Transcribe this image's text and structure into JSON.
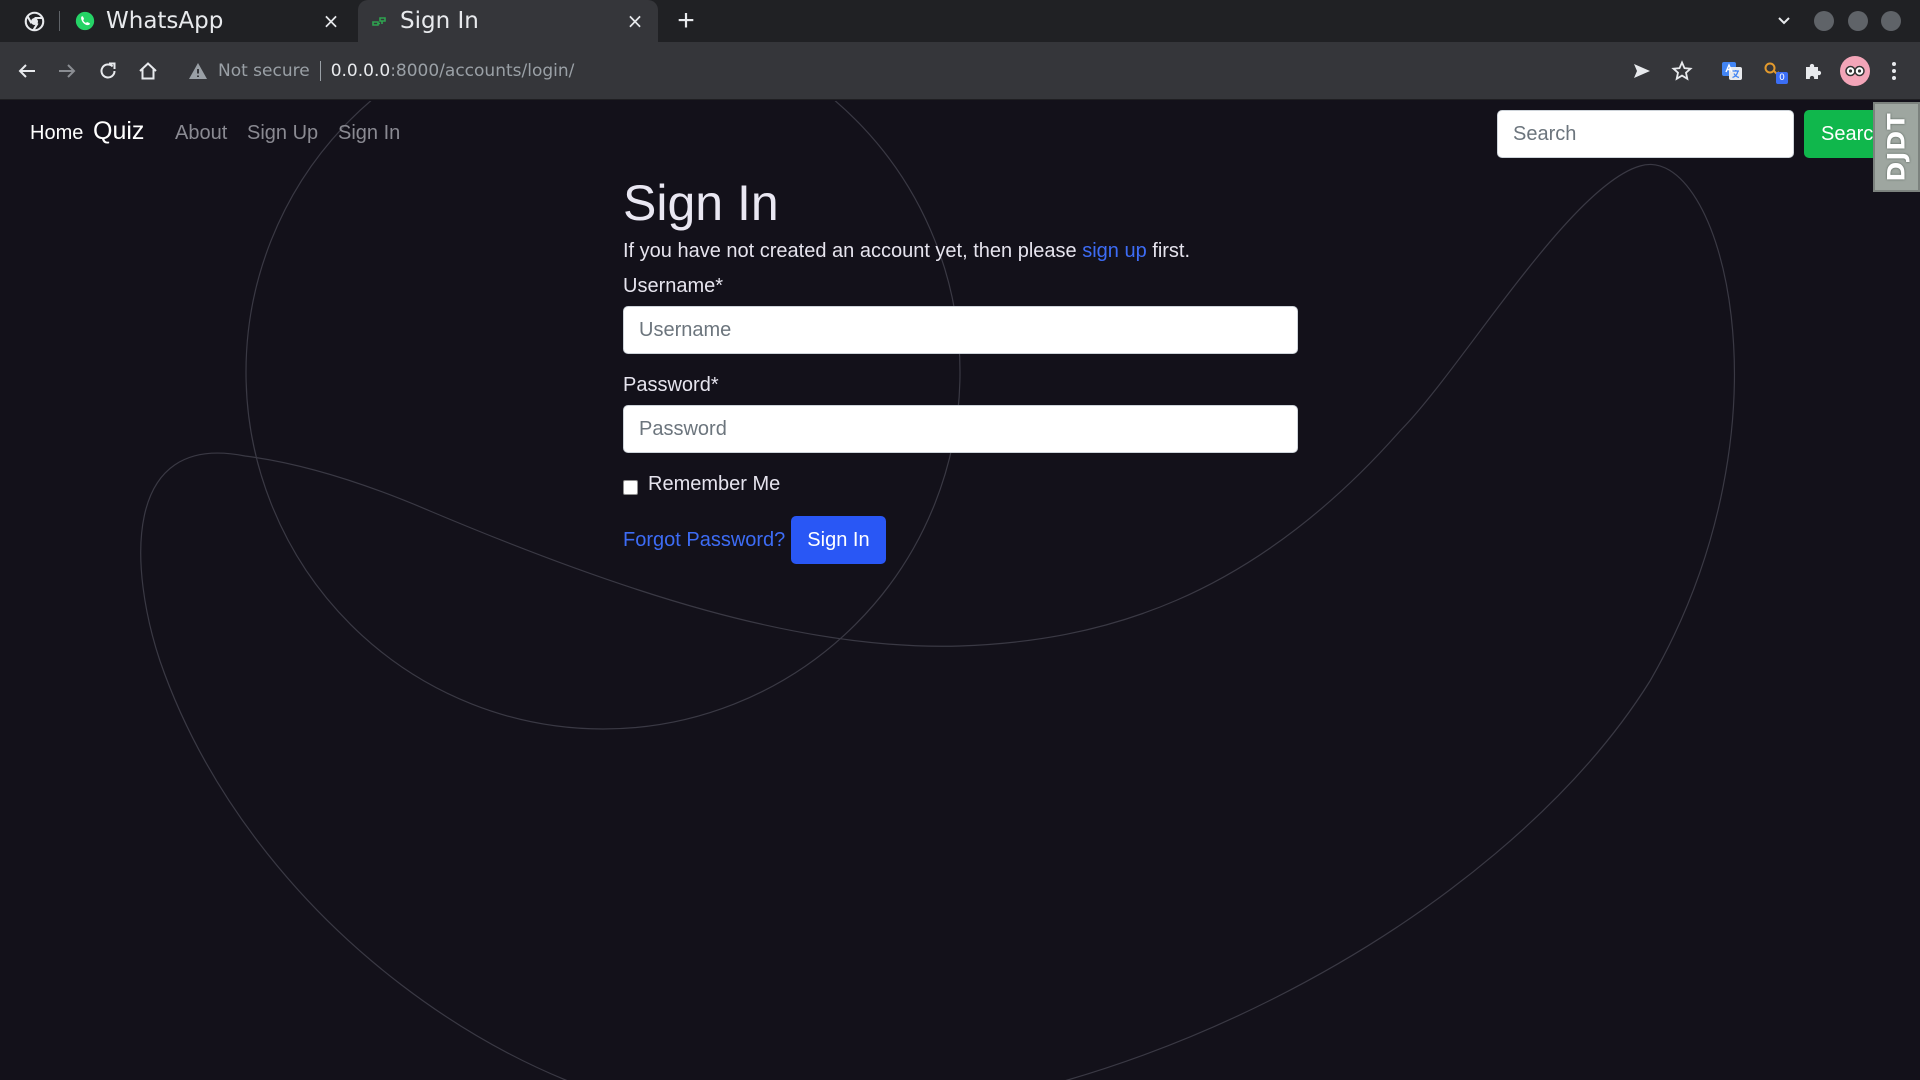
{
  "browser": {
    "tabs": [
      {
        "title": "WhatsApp",
        "close": "×"
      },
      {
        "title": "Sign In",
        "close": "×"
      }
    ],
    "new_tab": "+",
    "omnibox": {
      "security_text": "Not secure",
      "host": "0.0.0.0",
      "path": ":8000/accounts/login/"
    },
    "extension_badge": "0"
  },
  "nav": {
    "home": "Home",
    "brand": "Quiz",
    "about": "About",
    "signup": "Sign Up",
    "signin": "Sign In",
    "search_placeholder": "Search",
    "search_button": "Search",
    "debug_toolbar": "DJDT"
  },
  "form": {
    "title": "Sign In",
    "intro_before": "If you have not created an account yet, then please ",
    "intro_link": "sign up",
    "intro_after": " first.",
    "username_label": "Username*",
    "username_placeholder": "Username",
    "password_label": "Password*",
    "password_placeholder": "Password",
    "remember_label": "Remember Me",
    "forgot_link": "Forgot Password?",
    "submit_label": "Sign In"
  },
  "colors": {
    "page_background": "#13111a",
    "link": "#3d6cf5",
    "primary_button": "#2957f5",
    "search_button": "#10b74c"
  }
}
